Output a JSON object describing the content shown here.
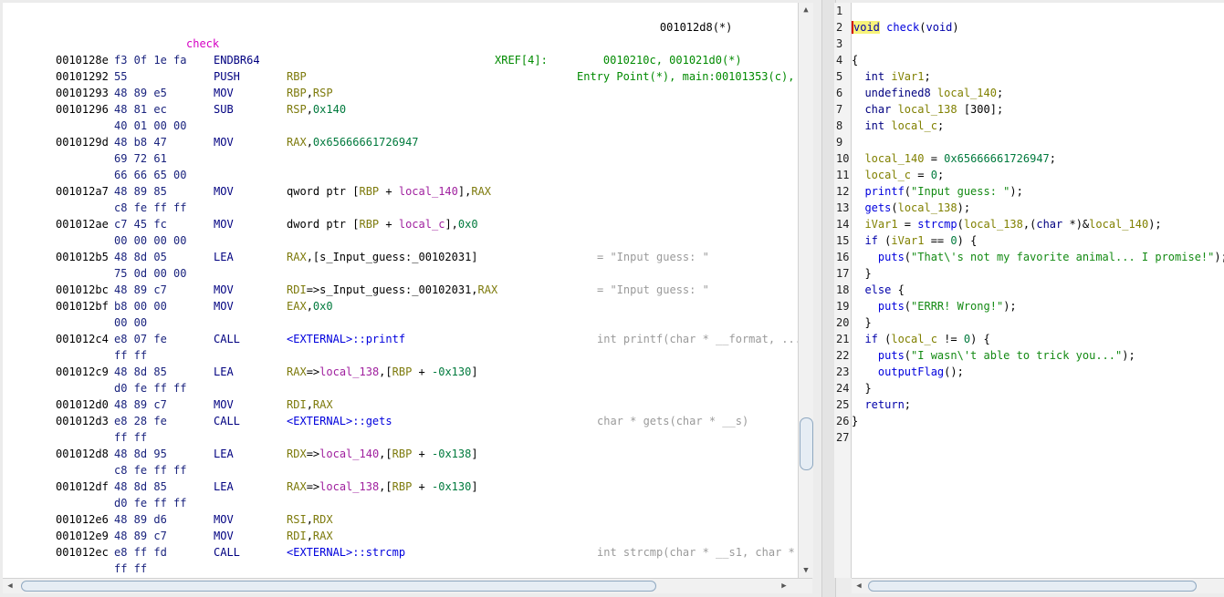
{
  "header": {
    "top_ref": "001012d8(*)",
    "func_name": "check",
    "xref_label": "XREF[4]:",
    "xref_line1": "Entry Point(*), main:00101353(c),",
    "xref_line2": "0010210c, 001021d0(*)"
  },
  "asm": [
    {
      "addr": "0010128e",
      "bytes": "f3 0f 1e fa",
      "mnem": "ENDBR64",
      "ops": [],
      "cmt": ""
    },
    {
      "addr": "00101292",
      "bytes": "55",
      "mnem": "PUSH",
      "ops": [
        {
          "t": "RBP",
          "c": "reg"
        }
      ],
      "cmt": ""
    },
    {
      "addr": "00101293",
      "bytes": "48 89 e5",
      "mnem": "MOV",
      "ops": [
        {
          "t": "RBP",
          "c": "reg"
        },
        {
          "t": ",",
          "c": "plain"
        },
        {
          "t": "RSP",
          "c": "reg"
        }
      ],
      "cmt": ""
    },
    {
      "addr": "00101296",
      "bytes": "48 81 ec",
      "mnem": "SUB",
      "ops": [
        {
          "t": "RSP",
          "c": "reg"
        },
        {
          "t": ",",
          "c": "plain"
        },
        {
          "t": "0x140",
          "c": "num"
        }
      ],
      "cmt": ""
    },
    {
      "addr": "",
      "bytes": "40 01 00 00",
      "mnem": "",
      "ops": [],
      "cmt": ""
    },
    {
      "addr": "0010129d",
      "bytes": "48 b8 47",
      "mnem": "MOV",
      "ops": [
        {
          "t": "RAX",
          "c": "reg"
        },
        {
          "t": ",",
          "c": "plain"
        },
        {
          "t": "0x65666661726947",
          "c": "num"
        }
      ],
      "cmt": ""
    },
    {
      "addr": "",
      "bytes": "69 72 61",
      "mnem": "",
      "ops": [],
      "cmt": ""
    },
    {
      "addr": "",
      "bytes": "66 66 65 00",
      "mnem": "",
      "ops": [],
      "cmt": ""
    },
    {
      "addr": "001012a7",
      "bytes": "48 89 85",
      "mnem": "MOV",
      "ops": [
        {
          "t": "qword ptr [",
          "c": "plain"
        },
        {
          "t": "RBP",
          "c": "reg"
        },
        {
          "t": " + ",
          "c": "plain"
        },
        {
          "t": "local_140",
          "c": "lbl"
        },
        {
          "t": "],",
          "c": "plain"
        },
        {
          "t": "RAX",
          "c": "reg"
        }
      ],
      "cmt": ""
    },
    {
      "addr": "",
      "bytes": "c8 fe ff ff",
      "mnem": "",
      "ops": [],
      "cmt": ""
    },
    {
      "addr": "001012ae",
      "bytes": "c7 45 fc",
      "mnem": "MOV",
      "ops": [
        {
          "t": "dword ptr [",
          "c": "plain"
        },
        {
          "t": "RBP",
          "c": "reg"
        },
        {
          "t": " + ",
          "c": "plain"
        },
        {
          "t": "local_c",
          "c": "lbl"
        },
        {
          "t": "],",
          "c": "plain"
        },
        {
          "t": "0x0",
          "c": "num"
        }
      ],
      "cmt": ""
    },
    {
      "addr": "",
      "bytes": "00 00 00 00",
      "mnem": "",
      "ops": [],
      "cmt": ""
    },
    {
      "addr": "001012b5",
      "bytes": "48 8d 05",
      "mnem": "LEA",
      "ops": [
        {
          "t": "RAX",
          "c": "reg"
        },
        {
          "t": ",[s_Input_guess:_00102031]",
          "c": "plain"
        }
      ],
      "cmt": "= \"Input guess: \""
    },
    {
      "addr": "",
      "bytes": "75 0d 00 00",
      "mnem": "",
      "ops": [],
      "cmt": ""
    },
    {
      "addr": "001012bc",
      "bytes": "48 89 c7",
      "mnem": "MOV",
      "ops": [
        {
          "t": "RDI",
          "c": "reg"
        },
        {
          "t": "=>s_Input_guess:_00102031,",
          "c": "plain"
        },
        {
          "t": "RAX",
          "c": "reg"
        }
      ],
      "cmt": "= \"Input guess: \""
    },
    {
      "addr": "001012bf",
      "bytes": "b8 00 00",
      "mnem": "MOV",
      "ops": [
        {
          "t": "EAX",
          "c": "reg"
        },
        {
          "t": ",",
          "c": "plain"
        },
        {
          "t": "0x0",
          "c": "num"
        }
      ],
      "cmt": ""
    },
    {
      "addr": "",
      "bytes": "00 00",
      "mnem": "",
      "ops": [],
      "cmt": ""
    },
    {
      "addr": "001012c4",
      "bytes": "e8 07 fe",
      "mnem": "CALL",
      "ops": [
        {
          "t": "<EXTERNAL>::printf",
          "c": "fn"
        }
      ],
      "cmt": "int printf(char * __format, ..."
    },
    {
      "addr": "",
      "bytes": "ff ff",
      "mnem": "",
      "ops": [],
      "cmt": ""
    },
    {
      "addr": "001012c9",
      "bytes": "48 8d 85",
      "mnem": "LEA",
      "ops": [
        {
          "t": "RAX",
          "c": "reg"
        },
        {
          "t": "=>",
          "c": "plain"
        },
        {
          "t": "local_138",
          "c": "lbl"
        },
        {
          "t": ",[",
          "c": "plain"
        },
        {
          "t": "RBP",
          "c": "reg"
        },
        {
          "t": " + ",
          "c": "plain"
        },
        {
          "t": "-0x130",
          "c": "num"
        },
        {
          "t": "]",
          "c": "plain"
        }
      ],
      "cmt": ""
    },
    {
      "addr": "",
      "bytes": "d0 fe ff ff",
      "mnem": "",
      "ops": [],
      "cmt": ""
    },
    {
      "addr": "001012d0",
      "bytes": "48 89 c7",
      "mnem": "MOV",
      "ops": [
        {
          "t": "RDI",
          "c": "reg"
        },
        {
          "t": ",",
          "c": "plain"
        },
        {
          "t": "RAX",
          "c": "reg"
        }
      ],
      "cmt": ""
    },
    {
      "addr": "001012d3",
      "bytes": "e8 28 fe",
      "mnem": "CALL",
      "ops": [
        {
          "t": "<EXTERNAL>::gets",
          "c": "fn"
        }
      ],
      "cmt": "char * gets(char * __s)"
    },
    {
      "addr": "",
      "bytes": "ff ff",
      "mnem": "",
      "ops": [],
      "cmt": ""
    },
    {
      "addr": "001012d8",
      "bytes": "48 8d 95",
      "mnem": "LEA",
      "ops": [
        {
          "t": "RDX",
          "c": "reg"
        },
        {
          "t": "=>",
          "c": "plain"
        },
        {
          "t": "local_140",
          "c": "lbl"
        },
        {
          "t": ",[",
          "c": "plain"
        },
        {
          "t": "RBP",
          "c": "reg"
        },
        {
          "t": " + ",
          "c": "plain"
        },
        {
          "t": "-0x138",
          "c": "num"
        },
        {
          "t": "]",
          "c": "plain"
        }
      ],
      "cmt": ""
    },
    {
      "addr": "",
      "bytes": "c8 fe ff ff",
      "mnem": "",
      "ops": [],
      "cmt": ""
    },
    {
      "addr": "001012df",
      "bytes": "48 8d 85",
      "mnem": "LEA",
      "ops": [
        {
          "t": "RAX",
          "c": "reg"
        },
        {
          "t": "=>",
          "c": "plain"
        },
        {
          "t": "local_138",
          "c": "lbl"
        },
        {
          "t": ",[",
          "c": "plain"
        },
        {
          "t": "RBP",
          "c": "reg"
        },
        {
          "t": " + ",
          "c": "plain"
        },
        {
          "t": "-0x130",
          "c": "num"
        },
        {
          "t": "]",
          "c": "plain"
        }
      ],
      "cmt": ""
    },
    {
      "addr": "",
      "bytes": "d0 fe ff ff",
      "mnem": "",
      "ops": [],
      "cmt": ""
    },
    {
      "addr": "001012e6",
      "bytes": "48 89 d6",
      "mnem": "MOV",
      "ops": [
        {
          "t": "RSI",
          "c": "reg"
        },
        {
          "t": ",",
          "c": "plain"
        },
        {
          "t": "RDX",
          "c": "reg"
        }
      ],
      "cmt": ""
    },
    {
      "addr": "001012e9",
      "bytes": "48 89 c7",
      "mnem": "MOV",
      "ops": [
        {
          "t": "RDI",
          "c": "reg"
        },
        {
          "t": ",",
          "c": "plain"
        },
        {
          "t": "RAX",
          "c": "reg"
        }
      ],
      "cmt": ""
    },
    {
      "addr": "001012ec",
      "bytes": "e8 ff fd",
      "mnem": "CALL",
      "ops": [
        {
          "t": "<EXTERNAL>::strcmp",
          "c": "fn"
        }
      ],
      "cmt": "int strcmp(char * __s1, char *"
    },
    {
      "addr": "",
      "bytes": "ff ff",
      "mnem": "",
      "ops": [],
      "cmt": ""
    }
  ],
  "line_numbers": [
    "1",
    "2",
    "3",
    "4",
    "5",
    "6",
    "7",
    "8",
    "9",
    "10",
    "11",
    "12",
    "13",
    "14",
    "15",
    "16",
    "17",
    "18",
    "19",
    "20",
    "21",
    "22",
    "23",
    "24",
    "25",
    "26",
    "27"
  ],
  "decomp": [
    [],
    [
      {
        "t": "void",
        "c": "kw"
      },
      {
        "t": " ",
        "c": "plain"
      },
      {
        "t": "check",
        "c": "fn"
      },
      {
        "t": "(",
        "c": "plain"
      },
      {
        "t": "void",
        "c": "kw"
      },
      {
        "t": ")",
        "c": "plain"
      }
    ],
    [],
    [
      {
        "t": "{",
        "c": "plain"
      }
    ],
    [
      {
        "t": "  int ",
        "c": "ty"
      },
      {
        "t": "iVar1",
        "c": "vr"
      },
      {
        "t": ";",
        "c": "plain"
      }
    ],
    [
      {
        "t": "  undefined8 ",
        "c": "ty"
      },
      {
        "t": "local_140",
        "c": "vr"
      },
      {
        "t": ";",
        "c": "plain"
      }
    ],
    [
      {
        "t": "  char ",
        "c": "ty"
      },
      {
        "t": "local_138",
        "c": "vr"
      },
      {
        "t": " [300];",
        "c": "plain"
      }
    ],
    [
      {
        "t": "  int ",
        "c": "ty"
      },
      {
        "t": "local_c",
        "c": "vr"
      },
      {
        "t": ";",
        "c": "plain"
      }
    ],
    [],
    [
      {
        "t": "  local_140",
        "c": "vr"
      },
      {
        "t": " = ",
        "c": "plain"
      },
      {
        "t": "0x65666661726947",
        "c": "num"
      },
      {
        "t": ";",
        "c": "plain"
      }
    ],
    [
      {
        "t": "  local_c",
        "c": "vr"
      },
      {
        "t": " = ",
        "c": "plain"
      },
      {
        "t": "0",
        "c": "num"
      },
      {
        "t": ";",
        "c": "plain"
      }
    ],
    [
      {
        "t": "  printf",
        "c": "fn"
      },
      {
        "t": "(",
        "c": "plain"
      },
      {
        "t": "\"Input guess: \"",
        "c": "str"
      },
      {
        "t": ");",
        "c": "plain"
      }
    ],
    [
      {
        "t": "  gets",
        "c": "fn"
      },
      {
        "t": "(",
        "c": "plain"
      },
      {
        "t": "local_138",
        "c": "vr"
      },
      {
        "t": ");",
        "c": "plain"
      }
    ],
    [
      {
        "t": "  iVar1",
        "c": "vr"
      },
      {
        "t": " = ",
        "c": "plain"
      },
      {
        "t": "strcmp",
        "c": "fn"
      },
      {
        "t": "(",
        "c": "plain"
      },
      {
        "t": "local_138",
        "c": "vr"
      },
      {
        "t": ",(",
        "c": "plain"
      },
      {
        "t": "char",
        "c": "ty"
      },
      {
        "t": " *)&",
        "c": "plain"
      },
      {
        "t": "local_140",
        "c": "vr"
      },
      {
        "t": ");",
        "c": "plain"
      }
    ],
    [
      {
        "t": "  if",
        "c": "kw"
      },
      {
        "t": " (",
        "c": "plain"
      },
      {
        "t": "iVar1",
        "c": "vr"
      },
      {
        "t": " == ",
        "c": "plain"
      },
      {
        "t": "0",
        "c": "num"
      },
      {
        "t": ") {",
        "c": "plain"
      }
    ],
    [
      {
        "t": "    puts",
        "c": "fn"
      },
      {
        "t": "(",
        "c": "plain"
      },
      {
        "t": "\"That\\'s not my favorite animal... I promise!\"",
        "c": "str"
      },
      {
        "t": ");",
        "c": "plain"
      }
    ],
    [
      {
        "t": "  }",
        "c": "plain"
      }
    ],
    [
      {
        "t": "  else",
        "c": "kw"
      },
      {
        "t": " {",
        "c": "plain"
      }
    ],
    [
      {
        "t": "    puts",
        "c": "fn"
      },
      {
        "t": "(",
        "c": "plain"
      },
      {
        "t": "\"ERRR! Wrong!\"",
        "c": "str"
      },
      {
        "t": ");",
        "c": "plain"
      }
    ],
    [
      {
        "t": "  }",
        "c": "plain"
      }
    ],
    [
      {
        "t": "  if",
        "c": "kw"
      },
      {
        "t": " (",
        "c": "plain"
      },
      {
        "t": "local_c",
        "c": "vr"
      },
      {
        "t": " != ",
        "c": "plain"
      },
      {
        "t": "0",
        "c": "num"
      },
      {
        "t": ") {",
        "c": "plain"
      }
    ],
    [
      {
        "t": "    puts",
        "c": "fn"
      },
      {
        "t": "(",
        "c": "plain"
      },
      {
        "t": "\"I wasn\\'t able to trick you...\"",
        "c": "str"
      },
      {
        "t": ");",
        "c": "plain"
      }
    ],
    [
      {
        "t": "    outputFlag",
        "c": "fn"
      },
      {
        "t": "();",
        "c": "plain"
      }
    ],
    [
      {
        "t": "  }",
        "c": "plain"
      }
    ],
    [
      {
        "t": "  return",
        "c": "kw"
      },
      {
        "t": ";",
        "c": "plain"
      }
    ],
    [
      {
        "t": "}",
        "c": "plain"
      }
    ],
    []
  ]
}
